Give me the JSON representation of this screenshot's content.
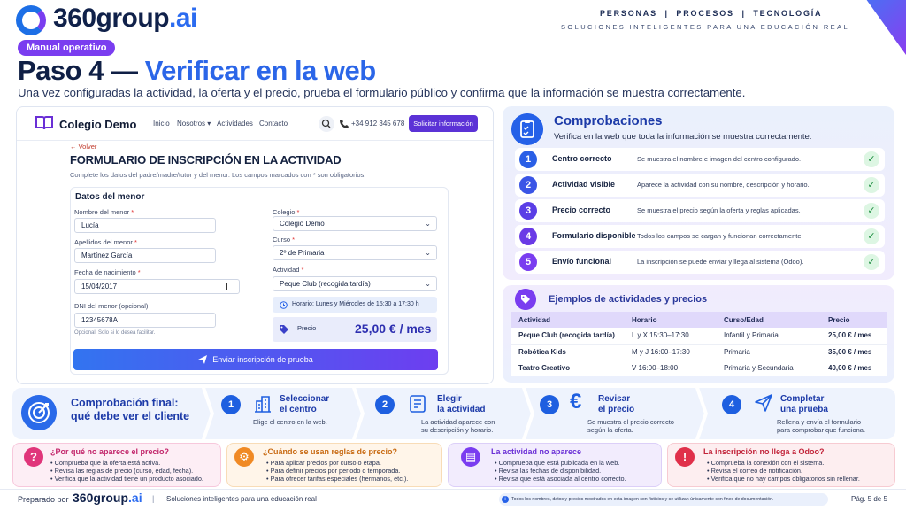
{
  "header": {
    "logo_main": "360group",
    "logo_suffix": ".ai",
    "tagline_top": "PERSONAS  |  PROCESOS  |  TECNOLOGÍA",
    "tagline_bottom": "SOLUCIONES INTELIGENTES PARA UNA EDUCACIÓN REAL",
    "badge": "Manual operativo",
    "title_part1": "Paso 4 — ",
    "title_part2": "Verificar en la web",
    "subtitle": "Una vez configuradas la actividad, la oferta y el precio, prueba el formulario público y confirma que la información se muestra correctamente."
  },
  "browser": {
    "brand": "Colegio Demo",
    "menu": [
      "Inicio",
      "Nosotros ▾",
      "Actividades",
      "Contacto"
    ],
    "phone": "+34 912 345 678",
    "cta": "Solicitar información",
    "back": "← Volver",
    "form_title": "FORMULARIO DE INSCRIPCIÓN EN LA ACTIVIDAD",
    "form_desc": "Complete los datos del padre/madre/tutor y del menor. Los campos marcados con * son obligatorios.",
    "card_title": "Datos del menor",
    "fields": {
      "nombre_label": "Nombre del menor",
      "nombre_value": "Lucía",
      "apellidos_label": "Apellidos del menor",
      "apellidos_value": "Martínez García",
      "fecha_label": "Fecha de nacimiento",
      "fecha_value": "15/04/2017",
      "dni_label": "DNI del menor (opcional)",
      "dni_value": "12345678A",
      "dni_hint": "Opcional. Solo si lo desea facilitar.",
      "colegio_label": "Colegio",
      "colegio_value": "Colegio Demo",
      "curso_label": "Curso",
      "curso_value": "2º de Primaria",
      "actividad_label": "Actividad",
      "actividad_value": "Peque Club (recogida tardía)",
      "required_mark": "*"
    },
    "schedule": "Horario: Lunes y Miércoles de 15:30 a 17:30 h",
    "price_label": "Precio",
    "price_value": "25,00 € / mes",
    "submit": "Enviar inscripción de prueba"
  },
  "checks": {
    "title": "Comprobaciones",
    "subtitle": "Verifica en la web que toda la información se muestra correctamente:",
    "items": [
      {
        "num": "1",
        "name": "Centro correcto",
        "desc": "Se muestra el nombre e imagen del centro configurado.",
        "color": "#2a5fe6"
      },
      {
        "num": "2",
        "name": "Actividad visible",
        "desc": "Aparece la actividad con su nombre, descripción y horario.",
        "color": "#3a55e6"
      },
      {
        "num": "3",
        "name": "Precio correcto",
        "desc": "Se muestra el precio según la oferta y reglas aplicadas.",
        "color": "#5a3ee6"
      },
      {
        "num": "4",
        "name": "Formulario disponible",
        "desc": "Todos los campos se cargan y funcionan correctamente.",
        "color": "#6a3ae6"
      },
      {
        "num": "5",
        "name": "Envío funcional",
        "desc": "La inscripción se puede enviar y llega al sistema (Odoo).",
        "color": "#7a3df0"
      }
    ],
    "tick": "✓"
  },
  "examples": {
    "title": "Ejemplos de actividades y precios",
    "headers": [
      "Actividad",
      "Horario",
      "Curso/Edad",
      "Precio"
    ],
    "rows": [
      [
        "Peque Club (recogida tardía)",
        "L y X 15:30–17:30",
        "Infantil y Primaria",
        "25,00 € / mes"
      ],
      [
        "Robótica Kids",
        "M y J 16:00–17:30",
        "Primaria",
        "35,00 € / mes"
      ],
      [
        "Teatro Creativo",
        "V 16:00–18:00",
        "Primaria y Secundaria",
        "40,00 € / mes"
      ]
    ]
  },
  "strip": {
    "title_line1": "Comprobación final:",
    "title_line2": "qué debe ver el cliente",
    "steps": [
      {
        "num": "1",
        "t1": "Seleccionar",
        "t2": "el centro",
        "d1": "Elige el centro en la web.",
        "d2": ""
      },
      {
        "num": "2",
        "t1": "Elegir",
        "t2": "la actividad",
        "d1": "La actividad aparece con",
        "d2": "su descripción y horario."
      },
      {
        "num": "3",
        "t1": "Revisar",
        "t2": "el precio",
        "d1": "Se muestra el precio correcto",
        "d2": "según la oferta."
      },
      {
        "num": "4",
        "t1": "Completar",
        "t2": "una prueba",
        "d1": "Rellena y envía el formulario",
        "d2": "para comprobar que funciona."
      }
    ]
  },
  "faq": [
    {
      "q": "¿Por qué no aparece el precio?",
      "icon": "?",
      "color": "#e0357a",
      "items": [
        "Comprueba que la oferta está activa.",
        "Revisa las reglas de precio (curso, edad, fecha).",
        "Verifica que la actividad tiene un producto asociado."
      ]
    },
    {
      "q": "¿Cuándo se usan reglas de precio?",
      "icon": "⚙",
      "color": "#f08a24",
      "items": [
        "Para aplicar precios por curso o etapa.",
        "Para definir precios por periodo o temporada.",
        "Para ofrecer tarifas especiales (hermanos, etc.)."
      ]
    },
    {
      "q": "La actividad no aparece",
      "icon": "▤",
      "color": "#7a3df0",
      "items": [
        "Comprueba que está publicada en la web.",
        "Revisa las fechas de disponibilidad.",
        "Revisa que está asociada al centro correcto."
      ]
    },
    {
      "q": "La inscripción no llega a Odoo?",
      "icon": "!",
      "color": "#e0304a",
      "items": [
        "Comprueba la conexión con el sistema.",
        "Revisa el correo de notificación.",
        "Verifica que no hay campos obligatorios sin rellenar."
      ]
    }
  ],
  "footer": {
    "prepared": "Preparado por",
    "logo_main": "360group",
    "logo_suffix": ".ai",
    "separator": "|",
    "tag": "Soluciones inteligentes para una educación real",
    "note": "Todos los nombres, datos y precios mostrados en esta imagen son ficticios y se utilizan únicamente con fines de documentación.",
    "page": "Pág. 5 de 5"
  }
}
